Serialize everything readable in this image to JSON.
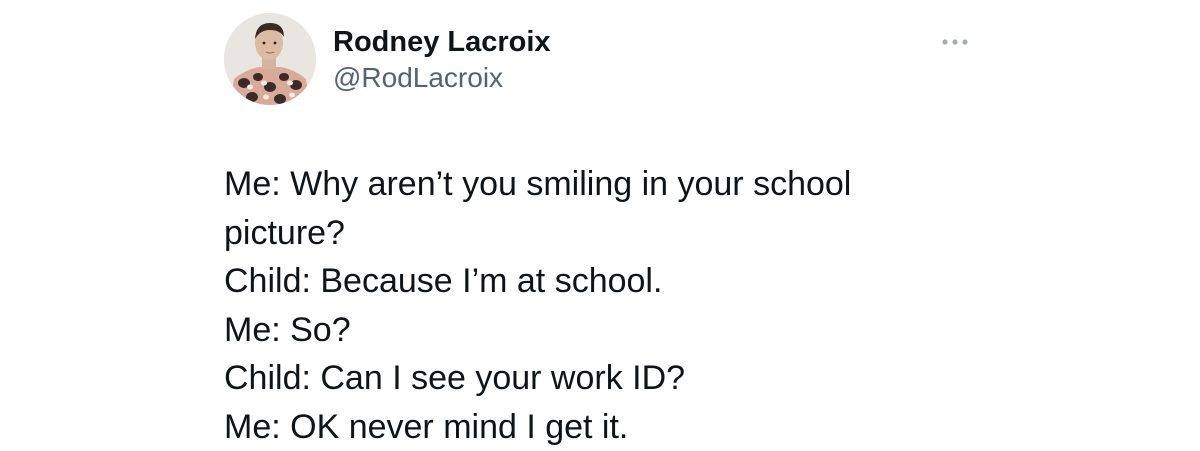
{
  "author": {
    "display_name": "Rodney Lacroix",
    "handle": "@RodLacroix",
    "avatar_icon": "user-avatar"
  },
  "more_icon": "more-horizontal-icon",
  "tweet": {
    "lines": [
      "Me: Why aren’t you smiling in your school",
      "picture?",
      "Child: Because I’m at school.",
      "Me: So?",
      "Child: Can I see your work ID?",
      "Me: OK never mind I get it."
    ]
  },
  "colors": {
    "text_primary": "#0f1419",
    "text_secondary": "#536471",
    "icon_muted": "#9aa4ad"
  }
}
